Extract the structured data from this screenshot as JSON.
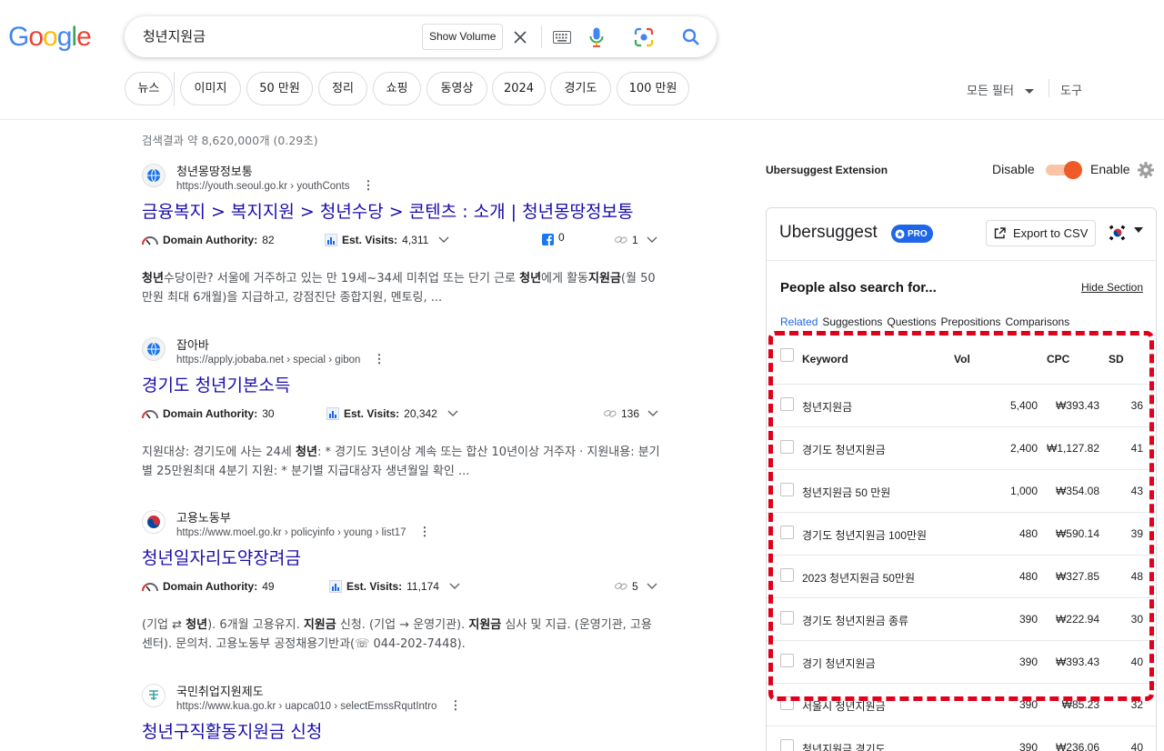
{
  "logo": {
    "letters": [
      "G",
      "o",
      "o",
      "g",
      "l",
      "e"
    ],
    "colors": [
      "#4285F4",
      "#EA4335",
      "#FBBC05",
      "#4285F4",
      "#34A853",
      "#EA4335"
    ]
  },
  "search": {
    "query": "청년지원금",
    "show_volume_label": "Show Volume"
  },
  "chips": [
    "뉴스",
    "이미지",
    "50 만원",
    "정리",
    "쇼핑",
    "동영상",
    "2024",
    "경기도",
    "100 만원"
  ],
  "tools": {
    "all_filters": "모든 필터",
    "tools": "도구"
  },
  "result_count": "검색결과 약 8,620,000개 (0.29초)",
  "results": [
    {
      "site_name": "청년몽땅정보통",
      "url": "https://youth.seoul.go.kr › youthConts",
      "title": "금융복지 > 복지지원 > 청년수당 > 콘텐츠 : 소개 | 청년몽땅정보통",
      "da_label": "Domain Authority:",
      "da": "82",
      "visits_label": "Est. Visits:",
      "visits": "4,311",
      "fb": "0",
      "links": "1",
      "snippet": [
        [
          "b",
          "청년"
        ],
        [
          "t",
          "수당이란? 서울에 거주하고 있는 만 19세~34세 미취업 또는 단기 근로 "
        ],
        [
          "b",
          "청년"
        ],
        [
          "t",
          "에게 활동"
        ],
        [
          "b",
          "지원금"
        ],
        [
          "t",
          "(월 50만원 최대 6개월)을 지급하고, 강점진단 종합지원, 멘토링, ..."
        ]
      ]
    },
    {
      "site_name": "잡아바",
      "url": "https://apply.jobaba.net › special › gibon",
      "title": "경기도 청년기본소득",
      "da_label": "Domain Authority:",
      "da": "30",
      "visits_label": "Est. Visits:",
      "visits": "20,342",
      "links": "136",
      "snippet": [
        [
          "t",
          "지원대상: 경기도에 사는 24세 "
        ],
        [
          "b",
          "청년"
        ],
        [
          "t",
          ": * 경기도 3년이상 계속 또는 합산 10년이상 거주자 · 지원내용: 분기별 25만원최대 4분기 지원: * 분기별 지급대상자 생년월일 확인 ..."
        ]
      ]
    },
    {
      "site_name": "고용노동부",
      "url": "https://www.moel.go.kr › policyinfo › young › list17",
      "title": "청년일자리도약장려금",
      "da_label": "Domain Authority:",
      "da": "49",
      "visits_label": "Est. Visits:",
      "visits": "11,174",
      "links": "5",
      "snippet": [
        [
          "t",
          "(기업 ⇄ "
        ],
        [
          "b",
          "청년"
        ],
        [
          "t",
          "). 6개월 고용유지. "
        ],
        [
          "b",
          "지원금"
        ],
        [
          "t",
          " 신청. (기업 → 운영기관). "
        ],
        [
          "b",
          "지원금"
        ],
        [
          "t",
          " 심사 및 지급. (운영기관, 고용센터). 문의처. 고용노동부 공정채용기반과(☏ 044-202-7448)."
        ]
      ]
    },
    {
      "site_name": "국민취업지원제도",
      "url": "https://www.kua.go.kr › uapca010 › selectEmssRqutIntro",
      "title": "청년구직활동지원금 신청"
    }
  ],
  "extension": {
    "title": "Ubersuggest Extension",
    "disable": "Disable",
    "enable": "Enable",
    "accent": "#f05a28"
  },
  "panel": {
    "logo": "Ubersuggest",
    "pro": "PRO",
    "export": "Export to CSV",
    "section_title": "People also search for...",
    "hide_section": "Hide Section",
    "tabs": [
      "Related",
      "Suggestions",
      "Questions",
      "Prepositions",
      "Comparisons"
    ],
    "columns": {
      "keyword": "Keyword",
      "vol": "Vol",
      "cpc": "CPC",
      "sd": "SD"
    },
    "rows": [
      {
        "keyword": "청년지원금",
        "vol": "5,400",
        "cpc": "₩393.43",
        "sd": "36"
      },
      {
        "keyword": "경기도 청년지원금",
        "vol": "2,400",
        "cpc": "₩1,127.82",
        "sd": "41"
      },
      {
        "keyword": "청년지원금 50 만원",
        "vol": "1,000",
        "cpc": "₩354.08",
        "sd": "43"
      },
      {
        "keyword": "경기도 청년지원금 100만원",
        "vol": "480",
        "cpc": "₩590.14",
        "sd": "39"
      },
      {
        "keyword": "2023 청년지원금 50만원",
        "vol": "480",
        "cpc": "₩327.85",
        "sd": "48"
      },
      {
        "keyword": "경기도 청년지원금 종류",
        "vol": "390",
        "cpc": "₩222.94",
        "sd": "30"
      },
      {
        "keyword": "경기 청년지원금",
        "vol": "390",
        "cpc": "₩393.43",
        "sd": "40"
      },
      {
        "keyword": "서울시 청년지원금",
        "vol": "390",
        "cpc": "₩85.23",
        "sd": "32"
      },
      {
        "keyword": "청년지원금 경기도",
        "vol": "390",
        "cpc": "₩236.06",
        "sd": "40"
      }
    ]
  }
}
